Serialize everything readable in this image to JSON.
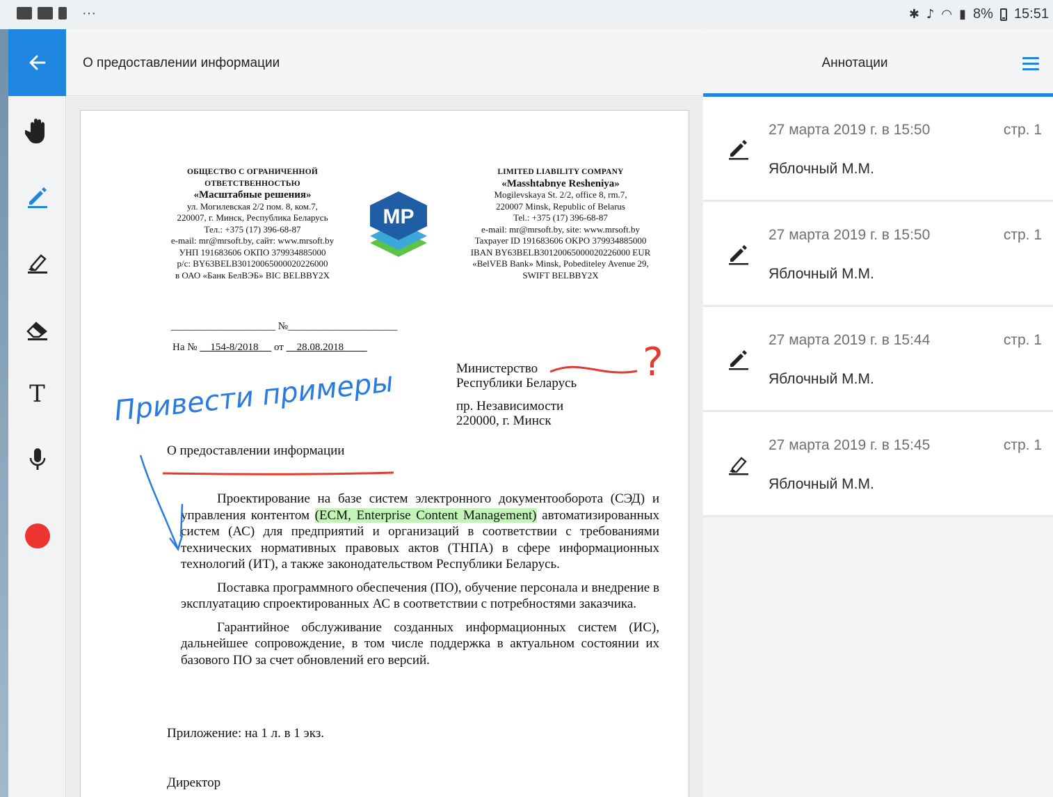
{
  "status_bar": {
    "left_icons": [
      "gallery-icon",
      "mail-icon",
      "clipboard-icon"
    ],
    "overflow": "···",
    "right_icons": [
      "bluetooth-icon",
      "mute-icon",
      "wifi-icon",
      "signal-icon"
    ],
    "battery": "8%",
    "time": "15:51"
  },
  "header": {
    "back_icon": "back-arrow-icon",
    "title": "О предоставлении информации"
  },
  "toolbar": {
    "tools": [
      "hand-icon",
      "pencil-icon",
      "highlighter-icon",
      "eraser-icon",
      "text-icon",
      "microphone-icon",
      "color-dot"
    ],
    "text_tool_glyph": "T",
    "active_tool": "pencil-icon",
    "accent_color": "#1f86e0",
    "current_color": "#ee3430"
  },
  "document": {
    "header_left": {
      "caption": "ОБЩЕСТВО С ОГРАНИЧЕННОЙ ОТВЕТСТВЕННОСТЬЮ",
      "name": "«Масштабные решения»",
      "lines": [
        "ул. Могилевская 2/2 пом. 8, ком.7,",
        "220007, г. Минск, Республика Беларусь",
        "Тел.: +375 (17) 396-68-87",
        "e-mail: mr@mrsoft.by, сайт: www.mrsoft.by",
        "УНП 191683606 ОКПО 379934885000",
        "р/с: BY63BELB30120065000020226000",
        "в ОАО «Банк БелВЭБ» BIC BELBBY2X"
      ]
    },
    "logo_text": "MP",
    "header_right": {
      "caption": "LIMITED LIABILITY COMPANY",
      "name": "«Masshtabnye Resheniya»",
      "lines": [
        "Mogilevskaya St. 2/2, office 8, rm.7,",
        "220007 Minsk, Republic of Belarus",
        "Tel.: +375 (17) 396-68-87",
        "e-mail: mr@mrsoft.by, site: www.mrsoft.by",
        "Taxpayer ID 191683606 OKPO 379934885000",
        "IBAN BY63BELB30120065000020226000 EUR",
        "«BelVEB Bank» Minsk, Pobediteley Avenue 29,",
        "SWIFT BELBBY2X"
      ]
    },
    "reg_line": "____________________ №_____________________",
    "ref_prefix": "На №",
    "ref_number": "154-8/2018",
    "ref_from": "от",
    "ref_date": "28.08.2018",
    "recipient": {
      "line1": "Министерство",
      "line2": "Республики Беларусь",
      "line3": "пр. Независимости",
      "line4": "220000, г. Минск"
    },
    "subject": "О предоставлении информации",
    "para1_before": "Проектирование на базе систем электронного документооборота (СЭД) и управления контентом ",
    "para1_highlight": "(ECM, Enterprise Content Management)",
    "para1_after": " автоматизированных систем (АС) для предприятий и организаций в соответствии с требованиями технических нормативных правовых актов (ТНПА) в сфере информационных технологий (ИТ), а также законодательством Республики Беларусь.",
    "para2": "Поставка программного обеспечения (ПО), обучение персонала и внедрение в эксплуатацию спроектированных АС в соответствии с потребностями заказчика.",
    "para3": "Гарантийное обслуживание созданных информационных систем (ИС), дальнейшее сопровождение, в том числе поддержка в актуальном состоянии их базового ПО за счет обновлений его версий.",
    "attachment": "Приложение: на 1 л. в 1 экз.",
    "signature_title": "Директор",
    "handwritten_note": "Привести примеры",
    "handwritten_mark": "?"
  },
  "annotations_panel": {
    "title": "Аннотации",
    "menu_icon": "menu-icon",
    "items": [
      {
        "date": "27 марта 2019 г. в 15:50",
        "page": "стр. 1",
        "author": "Яблочный М.М.",
        "icon": "pencil-icon"
      },
      {
        "date": "27 марта 2019 г. в 15:50",
        "page": "стр. 1",
        "author": "Яблочный М.М.",
        "icon": "pencil-icon"
      },
      {
        "date": "27 марта 2019 г. в 15:44",
        "page": "стр. 1",
        "author": "Яблочный М.М.",
        "icon": "pencil-icon"
      },
      {
        "date": "27 марта 2019 г. в 15:45",
        "page": "стр. 1",
        "author": "Яблочный М.М.",
        "icon": "highlighter-icon"
      }
    ]
  }
}
